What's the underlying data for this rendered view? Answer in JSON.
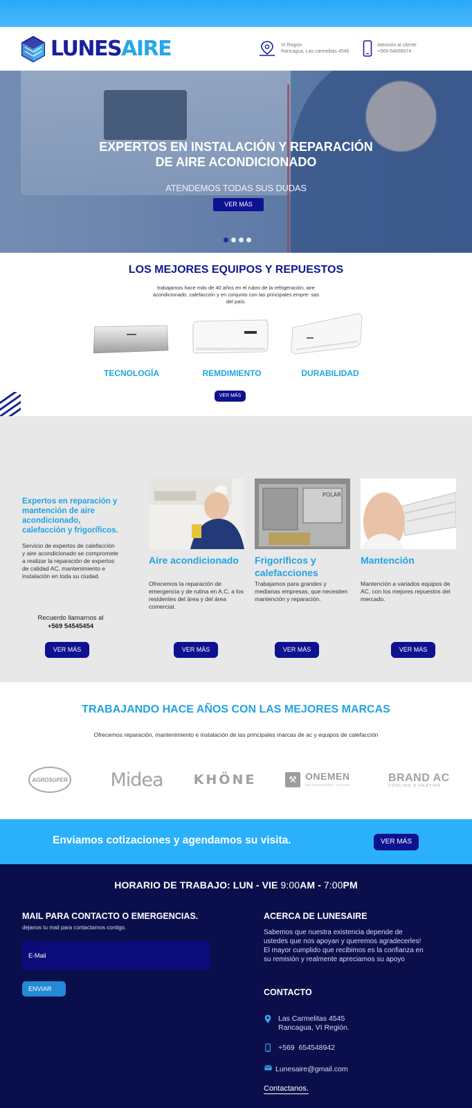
{
  "header": {
    "brand_main": "LUNES",
    "brand_accent": "AIRE",
    "location_line1": "VI Región",
    "location_line2": "Rancagua, Las carmelitas 4546",
    "phone_line1": "Atención al cliente",
    "phone_line2": "+569-54658974",
    "icons": [
      "map-pin-icon",
      "smartphone-icon"
    ]
  },
  "hero": {
    "title_line1": "EXPERTOS EN INSTALACIÓN Y REPARACIÓN",
    "title_line2": "DE AIRE ACONDICIONADO",
    "subtitle": "ATENDEMOS TODAS SUS DUDAS",
    "button": "VER MÁS",
    "slides": 4,
    "active_slide": 1
  },
  "products": {
    "title": "LOS MEJORES EQUIPOS Y REPUESTOS",
    "description": "trabajamos hace más de 40 años en el rubro de la refrigeración, aire acondicionado, calefacción y en conjunto con las principales empre- sas del país.",
    "features": [
      "TECNOLOGÍA",
      "REMDIMIENTO",
      "DURABILIDAD"
    ],
    "button": "VER MÁS"
  },
  "services": {
    "intro_title": "Expertos en reparación y mantención de aire acondicionado, calefacción y frigoríficos.",
    "intro_text": "Servicio de expertos de calefacción y aire acondicionado se compromete a realizar la reparación de expertos de calidad AC, mantenimiento e instalación en toda su ciudad.",
    "call_text": "Recuerdo llamarnos al",
    "call_phone": "+569 54545454",
    "cards": [
      {
        "title": "Aire acondicionado",
        "text": "Ofrecemos la reparación de emergencia y de rutina en A.C, a los residentes del área y del área comercial."
      },
      {
        "title": "Frigoríficos y calefacciones",
        "text": "Trabajamos para grandes y medianas empresas, que necesiten mantención y reparación."
      },
      {
        "title": "Mantención",
        "text": "Mantención a variados equipos de AC, con los mejores repuestos del mercado."
      }
    ],
    "button": "VER MÁS"
  },
  "brands": {
    "title": "TRABAJANDO HACE AÑOS CON LAS MEJORES MARCAS",
    "subtitle": "Ofrecemos reparación, mantenimiento e instalación de las principales marcas de ac y equipos de calefacción",
    "logos": [
      {
        "name": "AGROSUPER"
      },
      {
        "name": "Midea"
      },
      {
        "name": "KHÖNE"
      },
      {
        "name": "ONEMEN",
        "tagline": "AIR CONDITIONER · COOLING"
      },
      {
        "name": "BRAND AC",
        "tagline": "COOLING & HEATING"
      }
    ]
  },
  "cta": {
    "text": "Enviamos cotizaciones y agendamos su visita.",
    "button": "VER MÁS"
  },
  "footer": {
    "hours_bold": "HORARIO DE TRABAJO: LUN - VIE",
    "hours_open": "9:00",
    "hours_am": "AM - ",
    "hours_close": "7:00",
    "hours_pm": "PM",
    "mail_title": "MAIL PARA CONTACTO O EMERGENCIAS.",
    "mail_subtitle": "dejanos tu mail para contactarnos contigo.",
    "email_placeholder": "E-Mail",
    "send_button": "ENVIAR",
    "about_title": "ACERCA DE LUNESAIRE",
    "about_text": "Sabemos que nuestra existencia depende de ustedes que nos apoyan y queremos agradecerles! El mayor cumplido que recibimos es la confianza en su remisión y realmente apreciamos su apoyo",
    "contact_title": "CONTACTO",
    "address_line1": "Las Carmelitas 4545",
    "address_line2": "Rancagua, VI Región.",
    "phone": "+569  654548942",
    "email": "Lunesaire@gmail.com",
    "contact_link": "Contactanos."
  },
  "colors": {
    "top_bar": "#2aa8f5",
    "navy": "#0d1290",
    "accent_blue": "#22a3e0",
    "footer_bg": "#0a0f4c",
    "services_bg": "#e8e8e9",
    "cta_bg": "#2bb0fb"
  }
}
